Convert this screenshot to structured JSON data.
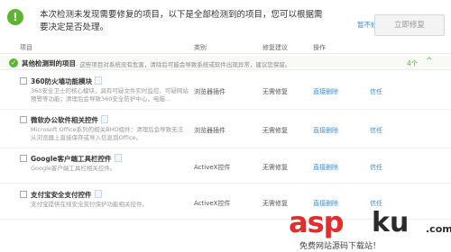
{
  "header": {
    "message": "本次检测未发现需要修复的项目，以下是全部检测到的项目，您可以根据需要决定是否处理。",
    "ignore_label": "暂不修复",
    "fix_now_label": "立即修复"
  },
  "columns": {
    "item": "项目",
    "category": "类别",
    "suggestion": "修复建议",
    "action": "操作"
  },
  "group": {
    "title": "其他检测到的项目",
    "description": "- 这些项目对系统没有危害，清除后可能会导致系统或软件出现异常，建议您保留。",
    "count": "4个",
    "arrow": "^"
  },
  "items": [
    {
      "name": "360防火墙功能模块",
      "desc": "360安全卫士的核心模块，具有可疑文件实时监控、可疑网站预警等功能；清理后会导致360安全防护中心，电脑...",
      "category": "浏览器插件",
      "suggestion": "无需修复",
      "action": "直接删除",
      "trust": "信任"
    },
    {
      "name": "微软办公软件相关控件",
      "desc": "Microsoft Office系列的相关BHO组件：清理后会导致无法从浏览器上直接保存或导入信息到Office。",
      "category": "浏览器插件",
      "suggestion": "无需修复",
      "action": "直接删除",
      "trust": "信任"
    },
    {
      "name": "Google客户端工具栏控件",
      "desc": "Google客户端工具栏相关控件。",
      "category": "ActiveX控件",
      "suggestion": "无需修复",
      "action": "直接删除",
      "trust": "信任"
    },
    {
      "name": "支付宝安全支付控件",
      "desc": "支付宝提供在线安全支付保护功能相关控件。",
      "category": "ActiveX控件",
      "suggestion": "无需修复",
      "action": "直接删除",
      "trust": "信任"
    }
  ],
  "watermark": {
    "asp": "asp",
    "ku": "ku",
    "dotcom": ".com",
    "sub": "免费网站源码下载站！"
  },
  "colors": {
    "accent_green": "#5cb531",
    "link_blue": "#3a8fd6",
    "watermark_red": "#e32c2c"
  }
}
